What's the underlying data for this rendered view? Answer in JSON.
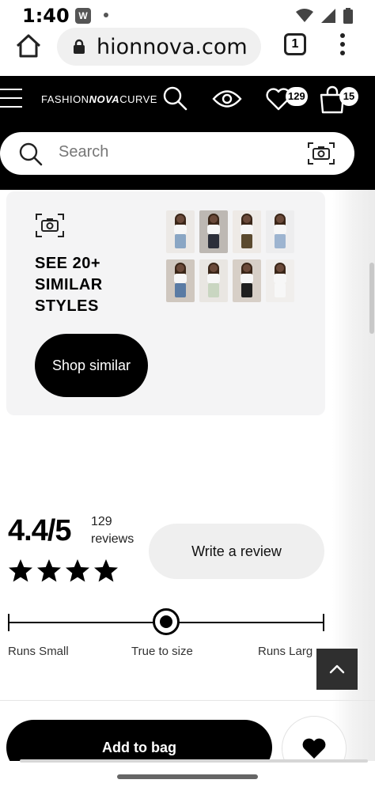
{
  "status_bar": {
    "time": "1:40",
    "app_letter": "W"
  },
  "browser": {
    "url": "hionnova.com",
    "tab_count": "1"
  },
  "header": {
    "logo_left": "FASHION",
    "logo_mid": "NOVA",
    "logo_right": "CURVE",
    "wishlist_count": "129",
    "bag_count": "15",
    "search_placeholder": "Search"
  },
  "similar": {
    "title": "SEE 20+ SIMILAR STYLES",
    "button_label": "Shop similar",
    "thumbnails": [
      {
        "bg": "#ece9e6",
        "bottom": "#8aa6c4"
      },
      {
        "bg": "#bdb8b3",
        "bottom": "#2c2f3a"
      },
      {
        "bg": "#eeeae6",
        "bottom": "#5b4a2f"
      },
      {
        "bg": "#ededee",
        "bottom": "#9db4d0"
      },
      {
        "bg": "#cfc7bf",
        "bottom": "#5a7ba4"
      },
      {
        "bg": "#e9e6e2",
        "bottom": "#c9d6c1"
      },
      {
        "bg": "#d7cfc7",
        "bottom": "#1f1f1f"
      },
      {
        "bg": "#f0eeec",
        "bottom": "#f7f7f7"
      }
    ]
  },
  "reviews": {
    "rating": "4.4/5",
    "count_number": "129",
    "count_word": "reviews",
    "stars_filled": 4,
    "write_label": "Write a review"
  },
  "fit": {
    "labels": [
      "Runs Small",
      "True to size",
      "Runs Larg"
    ],
    "position": 0.5
  },
  "actions": {
    "add_to_bag": "Add to bag"
  },
  "colors": {
    "header_bg": "#000000",
    "card_bg": "#f4f4f5",
    "button_bg": "#000000"
  }
}
